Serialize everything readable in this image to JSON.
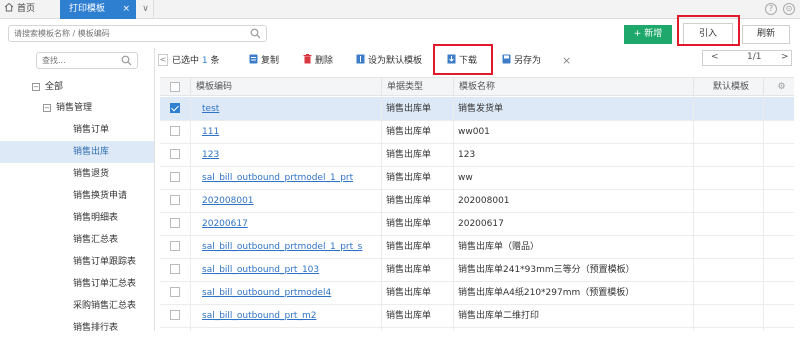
{
  "tabs": {
    "home": "首页",
    "print_template": "打印模板",
    "close": "×",
    "more": "∨"
  },
  "header_icons": {
    "help": "?",
    "settings": "⊙"
  },
  "search": {
    "placeholder": "请搜索模板名称 / 模板编码"
  },
  "actions": {
    "new": "+ 新增",
    "import": "引入",
    "refresh": "刷新"
  },
  "left_search": {
    "placeholder": "查找..."
  },
  "tree": [
    {
      "label": "全部",
      "toggle": "−"
    },
    {
      "label": "销售管理",
      "toggle": "−"
    },
    {
      "label": "销售订单"
    },
    {
      "label": "销售出库"
    },
    {
      "label": "销售退货"
    },
    {
      "label": "销售换货申请"
    },
    {
      "label": "销售明细表"
    },
    {
      "label": "销售汇总表"
    },
    {
      "label": "销售订单跟踪表"
    },
    {
      "label": "销售订单汇总表"
    },
    {
      "label": "采购销售汇总表"
    },
    {
      "label": "销售排行表"
    }
  ],
  "toolbar": {
    "selected_prefix": "已选中",
    "selected_count": "1",
    "selected_suffix": "条",
    "copy": "复制",
    "delete": "删除",
    "set_default": "设为默认模板",
    "download": "下载",
    "save_as": "另存为",
    "clear": "×"
  },
  "pager": {
    "prev": "<",
    "page": "1/1",
    "next": ">"
  },
  "columns": {
    "code": "模板编码",
    "doc_type": "单据类型",
    "name": "模板名称",
    "default": "默认模板"
  },
  "rows": [
    {
      "code": "test",
      "doc_type": "销售出库单",
      "name": "销售发货单",
      "checked": true
    },
    {
      "code": "111",
      "doc_type": "销售出库单",
      "name": "ww001",
      "checked": false
    },
    {
      "code": "123",
      "doc_type": "销售出库单",
      "name": "123",
      "checked": false
    },
    {
      "code": "sal_bill_outbound_prtmodel_1_prt",
      "doc_type": "销售出库单",
      "name": "ww",
      "checked": false
    },
    {
      "code": "202008001",
      "doc_type": "销售出库单",
      "name": "202008001",
      "checked": false
    },
    {
      "code": "20200617",
      "doc_type": "销售出库单",
      "name": "20200617",
      "checked": false
    },
    {
      "code": "sal_bill_outbound_prtmodel_1_prt_s",
      "doc_type": "销售出库单",
      "name": "销售出库单（赠品）",
      "checked": false
    },
    {
      "code": "sal_bill_outbound_prt_103",
      "doc_type": "销售出库单",
      "name": "销售出库单241*93mm三等分（预置模板）",
      "checked": false
    },
    {
      "code": "sal_bill_outbound_prtmodel4",
      "doc_type": "销售出库单",
      "name": "销售出库单A4纸210*297mm（预置模板）",
      "checked": false
    },
    {
      "code": "sal_bill_outbound_prt_m2",
      "doc_type": "销售出库单",
      "name": "销售出库单二维打印",
      "checked": false
    }
  ],
  "colors": {
    "accent": "#2f7fd1",
    "new_button": "#1fa86b",
    "highlight_box": "#e0192b",
    "selected_row": "#dde9f6"
  }
}
